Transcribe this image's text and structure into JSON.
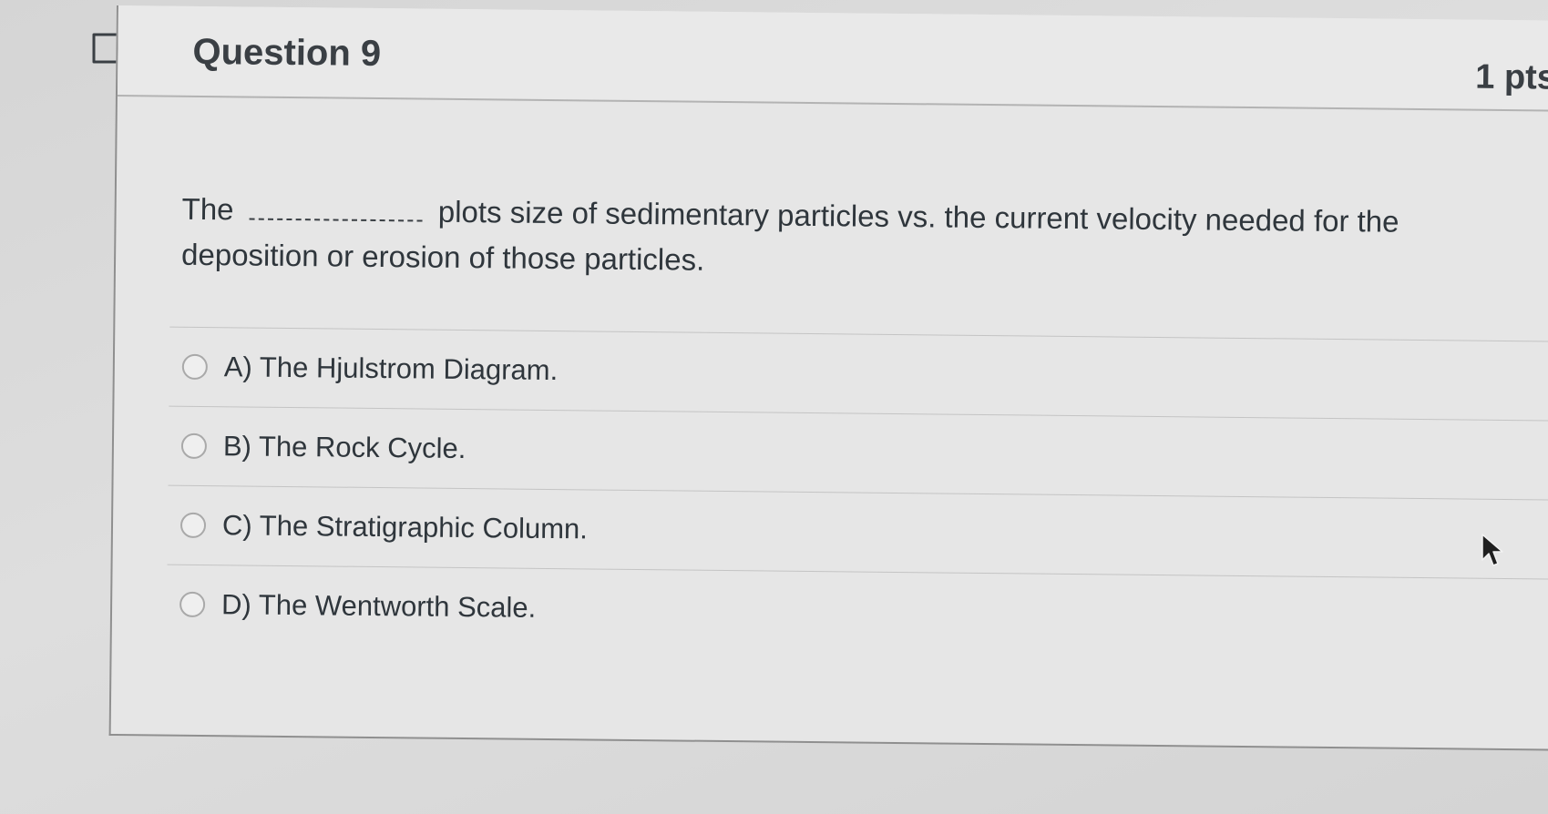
{
  "question": {
    "title": "Question 9",
    "points": "1 pts",
    "text_before": "The",
    "text_after": "plots size of sedimentary particles vs. the current velocity needed for the deposition or erosion of those particles."
  },
  "answers": [
    {
      "label": "A) The Hjulstrom Diagram."
    },
    {
      "label": "B) The Rock Cycle."
    },
    {
      "label": "C) The Stratigraphic Column."
    },
    {
      "label": "D) The Wentworth Scale."
    }
  ],
  "icons": {
    "flag": "flag-icon",
    "cursor": "mouse-pointer-icon"
  },
  "colors": {
    "text": "#2f363c",
    "background": "#e6e6e6",
    "border": "#8f8f8f"
  }
}
